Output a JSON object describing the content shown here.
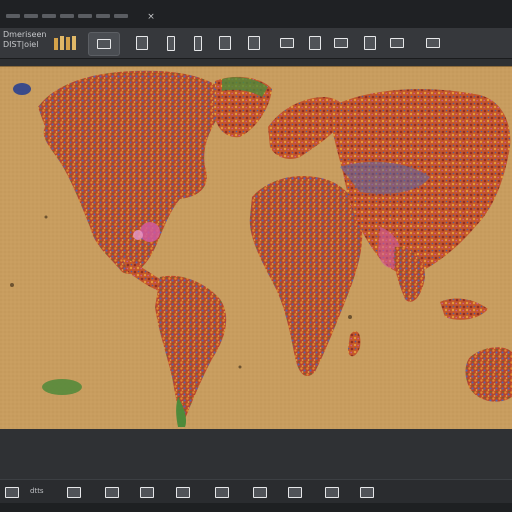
{
  "app": {
    "label_line1": "Dmeriseen",
    "label_line2": "DIST|oiel"
  },
  "titlebar": {
    "close_glyph": "×"
  },
  "toolbar": {
    "tools": [
      {
        "name": "palette-tool",
        "icon": "bars-icon"
      },
      {
        "name": "camera-tool",
        "icon": "camera-icon"
      },
      {
        "name": "layer-tool",
        "icon": "layer-icon"
      },
      {
        "name": "book-tool",
        "icon": "book-icon"
      },
      {
        "name": "phone-tool",
        "icon": "phone-icon"
      },
      {
        "name": "battery-tool",
        "icon": "battery-icon"
      },
      {
        "name": "device-tool",
        "icon": "device-icon"
      },
      {
        "name": "photo-tool",
        "icon": "photo-icon"
      },
      {
        "name": "mobile-tool",
        "icon": "mobile-icon"
      },
      {
        "name": "monitor-tool",
        "icon": "monitor-icon"
      },
      {
        "name": "stamp-tool",
        "icon": "stamp-icon"
      },
      {
        "name": "picture-tool",
        "icon": "picture-icon"
      },
      {
        "name": "share-tool",
        "icon": "share-icon"
      }
    ]
  },
  "map": {
    "description_colors": {
      "ocean": "#c69a5c",
      "land_red": "#b8442a",
      "land_orange": "#d67a2c",
      "land_blue": "#4b5ea0",
      "land_green": "#4f8a3a",
      "land_pink": "#d05a9c"
    }
  },
  "taskbar": {
    "label": "dtts"
  }
}
